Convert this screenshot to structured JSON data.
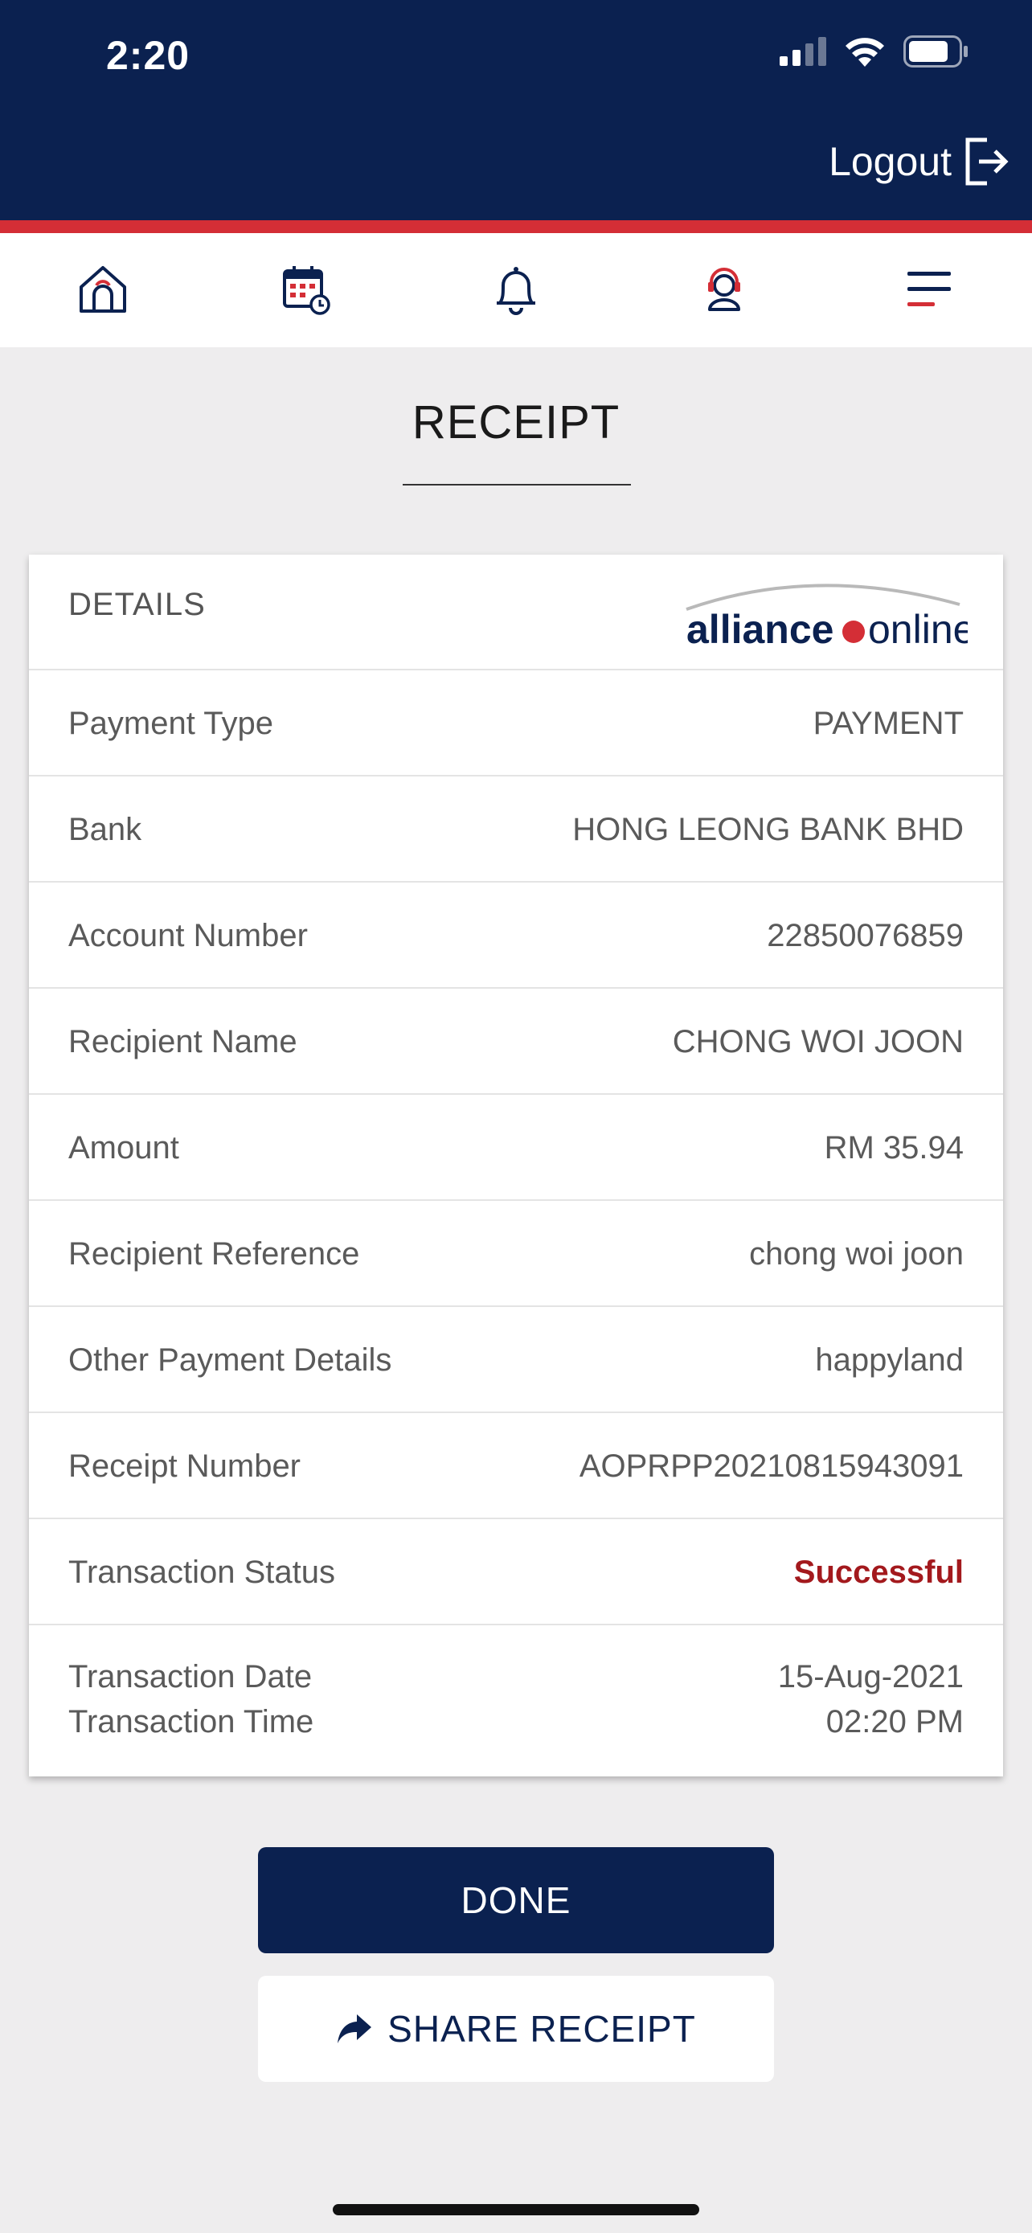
{
  "status_bar": {
    "time": "2:20"
  },
  "header": {
    "logout_label": "Logout"
  },
  "nav": {
    "items": [
      {
        "icon": "home-icon"
      },
      {
        "icon": "calendar-icon"
      },
      {
        "icon": "bell-icon"
      },
      {
        "icon": "support-agent-icon"
      },
      {
        "icon": "menu-icon"
      }
    ]
  },
  "page": {
    "title": "RECEIPT"
  },
  "receipt": {
    "header_label": "DETAILS",
    "logo_text_left": "alliance",
    "logo_text_right": "online",
    "rows": [
      {
        "label": "Payment Type",
        "value": "PAYMENT"
      },
      {
        "label": "Bank",
        "value": "HONG LEONG BANK BHD"
      },
      {
        "label": "Account Number",
        "value": "22850076859"
      },
      {
        "label": "Recipient Name",
        "value": "CHONG WOI JOON"
      },
      {
        "label": "Amount",
        "value": "RM 35.94"
      },
      {
        "label": "Recipient Reference",
        "value": "chong woi joon"
      },
      {
        "label": "Other Payment Details",
        "value": "happyland"
      },
      {
        "label": "Receipt Number",
        "value": "AOPRPP20210815943091"
      },
      {
        "label": "Transaction Status",
        "value": "Successful"
      }
    ],
    "date_label": "Transaction Date",
    "time_label": "Transaction Time",
    "date_value": "15-Aug-2021",
    "time_value": "02:20 PM"
  },
  "actions": {
    "done_label": "DONE",
    "share_label": "SHARE RECEIPT"
  },
  "colors": {
    "navy": "#0b2150",
    "red_accent": "#d42e36",
    "success_red": "#a3191d"
  }
}
